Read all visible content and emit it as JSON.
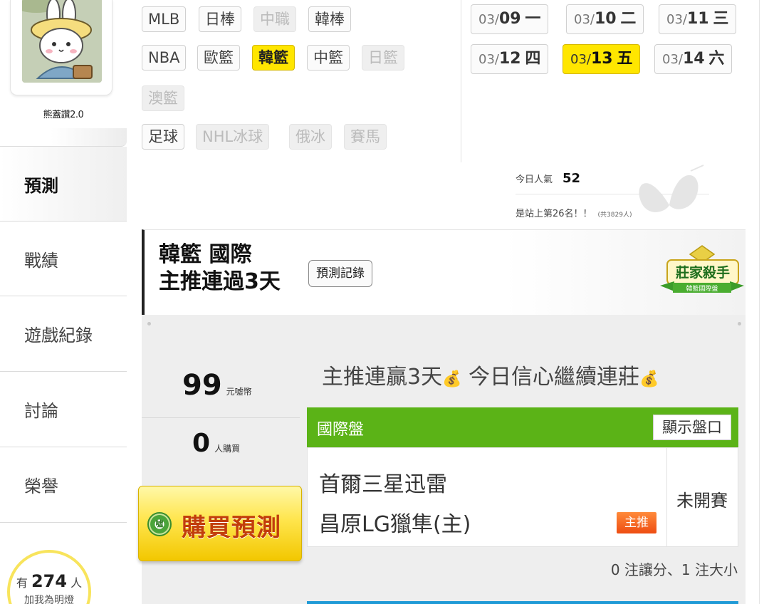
{
  "profile": {
    "username": "熊蓋讚2.0"
  },
  "nav": {
    "predict": "預測",
    "record": "戰績",
    "games": "遊戲紀錄",
    "discuss": "討論",
    "honor": "榮譽"
  },
  "likes": {
    "prefix": "有",
    "count": "274",
    "suffix": "人",
    "sub": "加我為明燈"
  },
  "sport_tags": [
    {
      "label": "MLB",
      "state": "normal"
    },
    {
      "label": "日棒",
      "state": "normal"
    },
    {
      "label": "中職",
      "state": "disabled"
    },
    {
      "label": "韓棒",
      "state": "normal"
    },
    {
      "label": "NBA",
      "state": "normal"
    },
    {
      "label": "歐籃",
      "state": "normal"
    },
    {
      "label": "韓籃",
      "state": "active"
    },
    {
      "label": "中籃",
      "state": "normal"
    },
    {
      "label": "日籃",
      "state": "disabled"
    },
    {
      "label": "澳籃",
      "state": "disabled"
    },
    {
      "label": "足球",
      "state": "normal"
    },
    {
      "label": "NHL冰球",
      "state": "disabled"
    },
    {
      "label": "俄冰",
      "state": "disabled"
    },
    {
      "label": "賽馬",
      "state": "disabled"
    }
  ],
  "dates": [
    {
      "month": "03/",
      "day": "09",
      "weekday": "一",
      "active": false
    },
    {
      "month": "03/",
      "day": "10",
      "weekday": "二",
      "active": false
    },
    {
      "month": "03/",
      "day": "11",
      "weekday": "三",
      "active": false
    },
    {
      "month": "03/",
      "day": "12",
      "weekday": "四",
      "active": false
    },
    {
      "month": "03/",
      "day": "13",
      "weekday": "五",
      "active": true
    },
    {
      "month": "03/",
      "day": "14",
      "weekday": "六",
      "active": false
    }
  ],
  "popularity": {
    "label": "今日人氣",
    "value": "52",
    "rank_text": "是站上第26名！！",
    "total": "(共3829人)"
  },
  "header": {
    "league": "韓籃 國際",
    "streak": "主推連過3天",
    "record_button": "預測記錄",
    "badge_title": "莊家殺手",
    "badge_sub": "韓籃國際盤"
  },
  "purchase": {
    "price": "99",
    "price_unit": "元噓幣",
    "buyers": "0",
    "buyers_unit": "人購買",
    "buy_button": "購買預測",
    "coin_icon_text": "噓"
  },
  "slogan": {
    "text1": "主推連贏3天",
    "text2": " 今日信心繼續連莊",
    "icon": "💰"
  },
  "market": {
    "label": "國際盤",
    "show_line_button": "顯示盤口"
  },
  "match": {
    "away_team": "首爾三星迅雷",
    "home_team": "昌原LG獵隼(主)",
    "pick_badge": "主推",
    "status": "未開賽"
  },
  "bet_summary": "0 注讓分、1 注大小",
  "colors": {
    "accent_yellow": "#ffe600",
    "market_green": "#5bb317",
    "pick_orange": "#ee4d12",
    "buy_text": "#c23d0a"
  }
}
